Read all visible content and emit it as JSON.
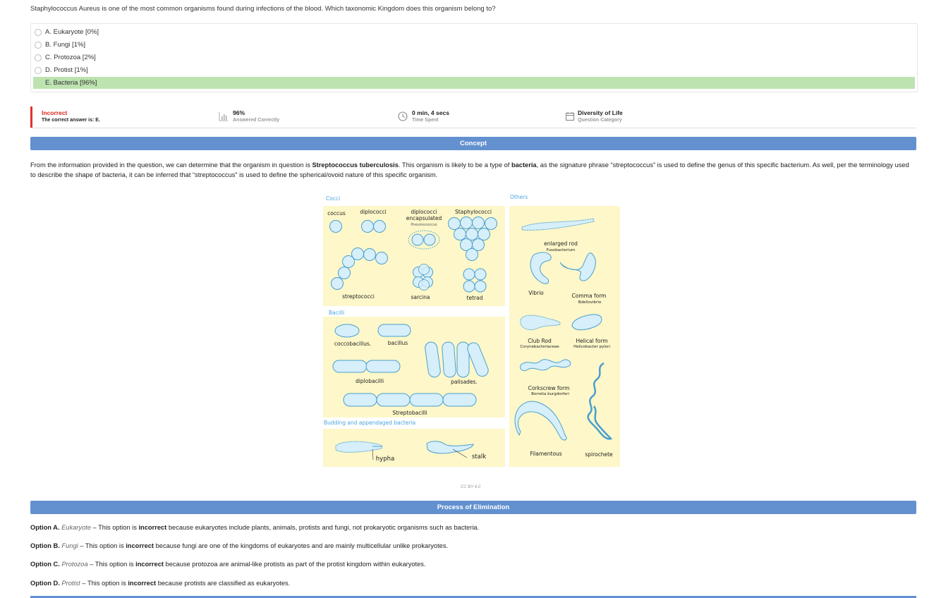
{
  "question": "Staphylococcus Aureus is one of the most common organisms found during infections of the blood. Which taxonomic Kingdom does this organism belong to?",
  "options": [
    {
      "label": "A. Eukaryote [0%]"
    },
    {
      "label": "B. Fungi [1%]"
    },
    {
      "label": "C. Protozoa [2%]"
    },
    {
      "label": "D. Protist [1%]"
    },
    {
      "label": "E. Bacteria [96%]"
    }
  ],
  "result": {
    "status": "Incorrect",
    "correct_answer": "The correct answer is: E.",
    "percent": "96%",
    "percent_label": "Answered Correctly",
    "time": "0 min, 4 secs",
    "time_label": "Time Spent",
    "category": "Diversity of Life",
    "category_label": "Question Category"
  },
  "concept": {
    "heading": "Concept",
    "p1": "From the information provided in the question, we can determine that the organism in question is ",
    "b1": "Streptococcus tuberculosis",
    "p2": ". This organism is likely to be a type of ",
    "b2": "bacteria",
    "p3": ", as the signature phrase “streptococcus” is used to define the genus of this specific bacterium. As well, per the terminology used to describe the shape of bacteria, it can be inferred that “streptococcus” is used to define the spherical/ovoid nature of this specific organism."
  },
  "figure": {
    "cocci": "Cocci",
    "others": "Others",
    "bacilli": "Bacilli",
    "budding": "Budding and appendaged bacteria",
    "coccus": "coccus",
    "diplococci": "diplococci",
    "diplo_enc1": "diplococci",
    "diplo_enc2": "encapsulated",
    "pneumococcus": "Pneumococcus",
    "staphylococci": "Staphylococci",
    "streptococci": "streptococci",
    "sarcina": "sarcina",
    "tetrad": "tetrad",
    "coccobacillus": "coccobacillus.",
    "bacillus": "bacillus",
    "diplobacilli": "diplobacilli",
    "palisades": "palisades.",
    "streptobacilli": "Streptobacilli",
    "hypha": "hypha",
    "stalk": "stalk",
    "enlarged_rod": "enlarged rod",
    "fusobacterium": "Fusobacterium",
    "vibrio": "Vibrio",
    "comma": "Comma form",
    "bdellovibrio": "Bdellovibrio",
    "club_rod": "Club Rod",
    "corynebacteriaceae": "Corynebacteriaceae",
    "helical": "Helical form",
    "helicobacter": "Helicobacter pylori",
    "corkscrew": "Corkscrew form",
    "borrelia": "Borrelia burgdorferi",
    "filamentous": "Filamentous",
    "spirochete": "spirochete"
  },
  "credit": "CC BY 4.0",
  "elimination": {
    "heading": "Process of Elimination",
    "items": [
      {
        "opt": "Option A.",
        "name": "Eukaryote",
        "pre": " – This option is ",
        "bold": "incorrect",
        "rest": " because eukaryotes include plants, animals, protists and fungi, not prokaryotic organisms such as bacteria."
      },
      {
        "opt": "Option B.",
        "name": "Fungi",
        "pre": " – This option is ",
        "bold": "incorrect",
        "rest": " because fungi are one of the kingdoms of eukaryotes and are mainly multicellular unlike prokaryotes."
      },
      {
        "opt": "Option C.",
        "name": "Protozoa",
        "pre": " – This option is ",
        "bold": "incorrect",
        "rest": " because protozoa are animal-like protists as part of the protist kingdom within eukaryotes."
      },
      {
        "opt": "Option D.",
        "name": "Protist",
        "pre": " – This option is ",
        "bold": "incorrect",
        "rest": " because protists are classified as eukaryotes."
      }
    ]
  },
  "colors": {
    "accent": "#6391d0",
    "correct_bg": "#bde3b0",
    "incorrect": "#e4302a",
    "panel": "#fdf7c9",
    "cell": "#d6effa",
    "cell_stroke": "#4a9fd0"
  }
}
